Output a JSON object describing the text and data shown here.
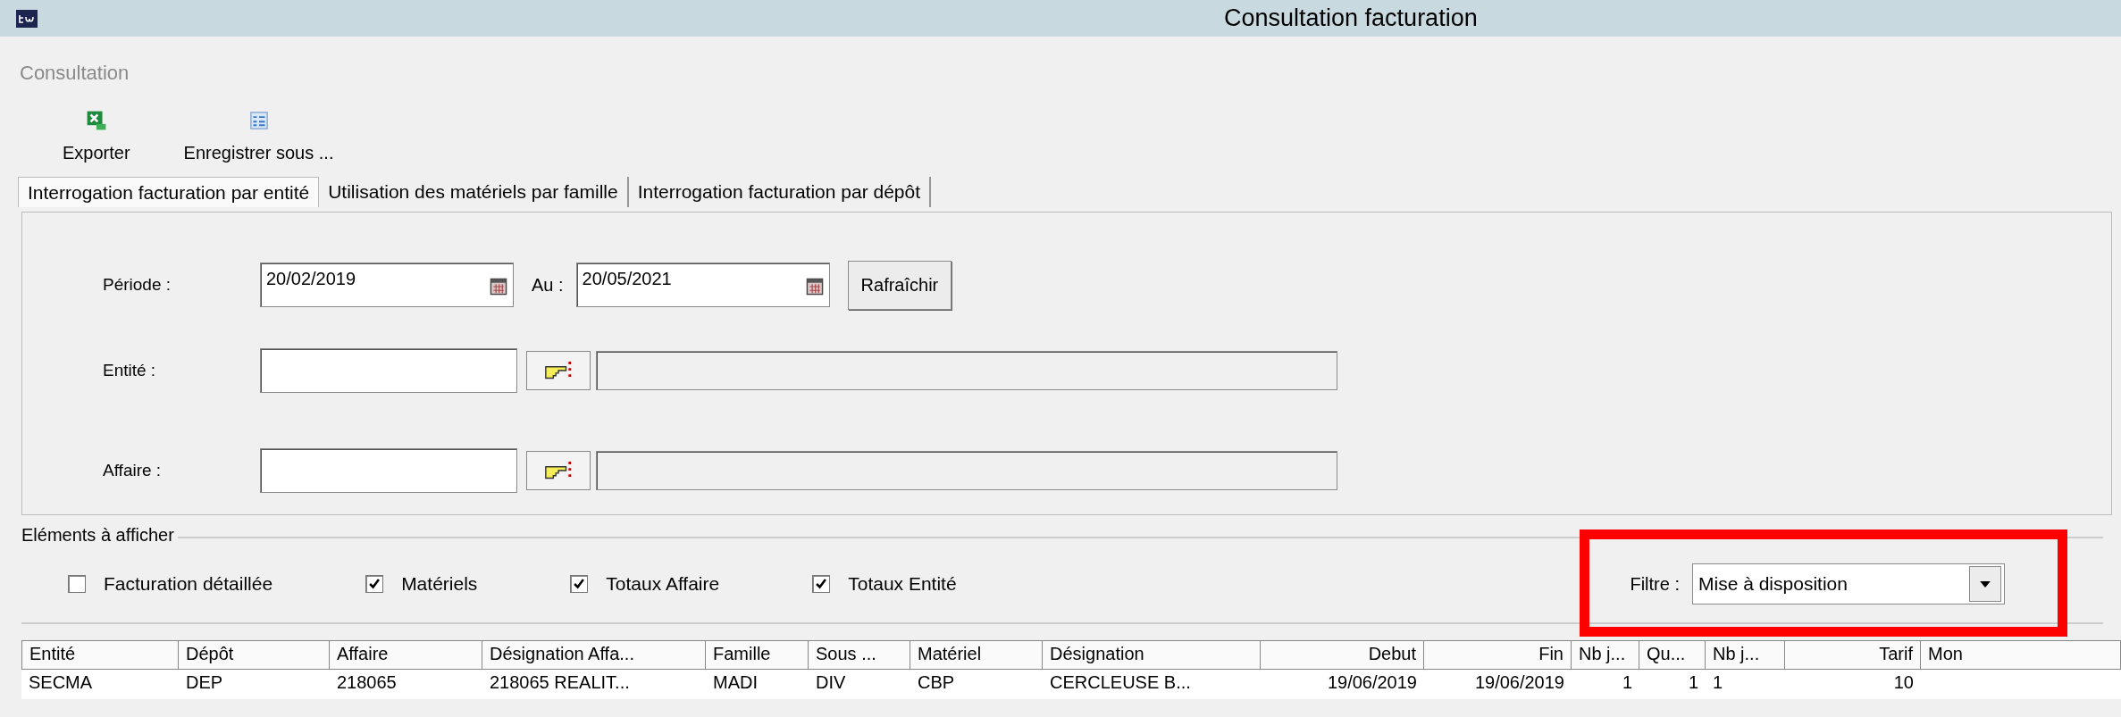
{
  "window": {
    "title": "Consultation facturation"
  },
  "menu": {
    "label": "Consultation"
  },
  "toolbar": [
    {
      "label": "Exporter",
      "kind": "excel"
    },
    {
      "label": "Enregistrer sous ...",
      "kind": "save"
    }
  ],
  "tabs": [
    {
      "label": "Interrogation facturation par entité",
      "selected": true
    },
    {
      "label": "Utilisation des matériels par famille",
      "selected": false
    },
    {
      "label": "Interrogation facturation par dépôt",
      "selected": false
    }
  ],
  "form": {
    "period": {
      "label": "Période :",
      "from": "20/02/2019",
      "to_label": "Au :",
      "to": "20/05/2021",
      "refresh": "Rafraîchir"
    },
    "lookups": [
      {
        "label": "Entité :"
      },
      {
        "label": "Affaire :"
      }
    ]
  },
  "display": {
    "legend": "Eléments à afficher",
    "options": [
      {
        "label": "Facturation détaillée",
        "checked": false
      },
      {
        "label": "Matériels",
        "checked": true
      },
      {
        "label": "Totaux Affaire",
        "checked": true
      },
      {
        "label": "Totaux Entité",
        "checked": true
      }
    ],
    "filter": {
      "label": "Filtre :",
      "value": "Mise à disposition"
    }
  },
  "table": {
    "columns": [
      "Entité",
      "Dépôt",
      "Affaire",
      "Désignation Affa...",
      "Famille",
      "Sous ...",
      "Matériel",
      "Désignation",
      "Debut",
      "Fin",
      "Nb j...",
      "Qu...",
      "Nb j...",
      "Tarif",
      "Mon"
    ],
    "rows": [
      [
        "SECMA",
        "DEP",
        "218065",
        "218065 REALIT...",
        "MADI",
        "DIV",
        "CBP",
        "CERCLEUSE B...",
        "19/06/2019",
        "19/06/2019",
        "1",
        "1",
        "1",
        "10"
      ]
    ]
  }
}
